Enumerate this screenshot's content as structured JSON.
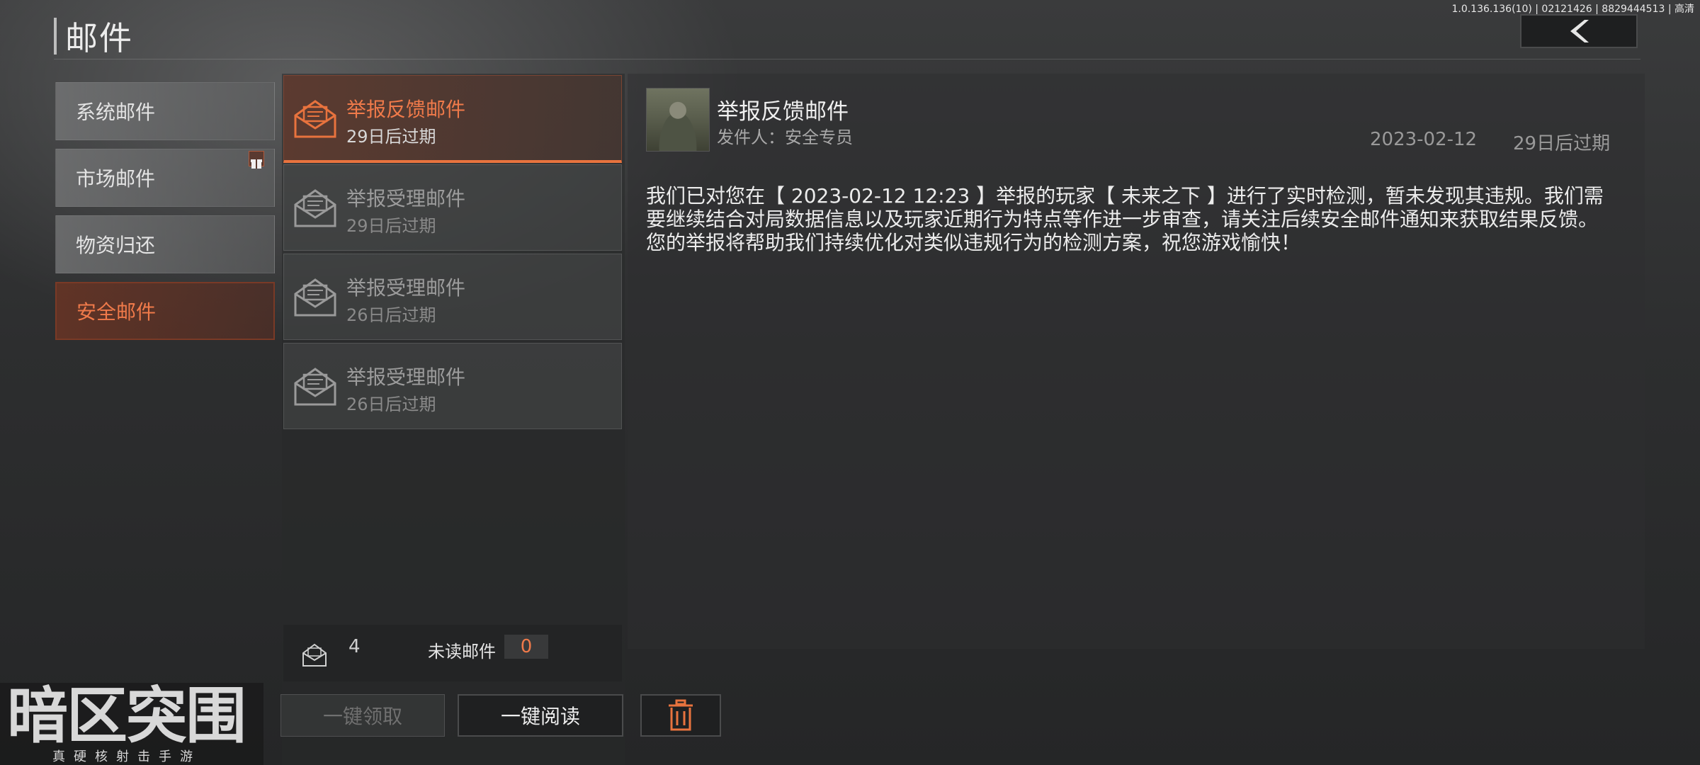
{
  "build_info": "1.0.136.136(10) | 02121426 | 8829444513 | 高清",
  "header": {
    "title": "邮件",
    "back_icon": "chevron-left-icon"
  },
  "categories": [
    {
      "label": "系统邮件",
      "active": false
    },
    {
      "label": "市场邮件",
      "active": false,
      "badge_icon": "gift-icon"
    },
    {
      "label": "物资归还",
      "active": false
    },
    {
      "label": "安全邮件",
      "active": true
    }
  ],
  "mails": [
    {
      "title": "举报反馈邮件",
      "expire": "29日后过期",
      "active": true,
      "icon": "envelope-open-icon"
    },
    {
      "title": "举报受理邮件",
      "expire": "29日后过期",
      "active": false,
      "icon": "envelope-open-icon"
    },
    {
      "title": "举报受理邮件",
      "expire": "26日后过期",
      "active": false,
      "icon": "envelope-open-icon"
    },
    {
      "title": "举报受理邮件",
      "expire": "26日后过期",
      "active": false,
      "icon": "envelope-open-icon"
    }
  ],
  "footer": {
    "total_count": "4",
    "unread_label": "未读邮件",
    "unread_count": "0"
  },
  "actions": {
    "claim_all": "一键领取",
    "read_all": "一键阅读",
    "delete_icon": "trash-icon"
  },
  "detail": {
    "title": "举报反馈邮件",
    "sender": "发件人：安全专员",
    "date": "2023-02-12",
    "expire": "29日后过期",
    "body_lines": [
      "我们已对您在【 2023-02-12 12:23 】举报的玩家【 未来之下 】进行了实时检测，暂未发现其违规。我们需",
      "要继续结合对局数据信息以及玩家近期行为特点等作进一步审查，请关注后续安全邮件通知来获取结果反馈。",
      "您的举报将帮助我们持续优化对类似违规行为的检测方案，祝您游戏愉快！"
    ]
  },
  "logo": {
    "main": "暗区突围",
    "tagline": "真硬核射击手游"
  },
  "colors": {
    "accent": "#f07a4a",
    "accent_border": "#e8733e"
  }
}
